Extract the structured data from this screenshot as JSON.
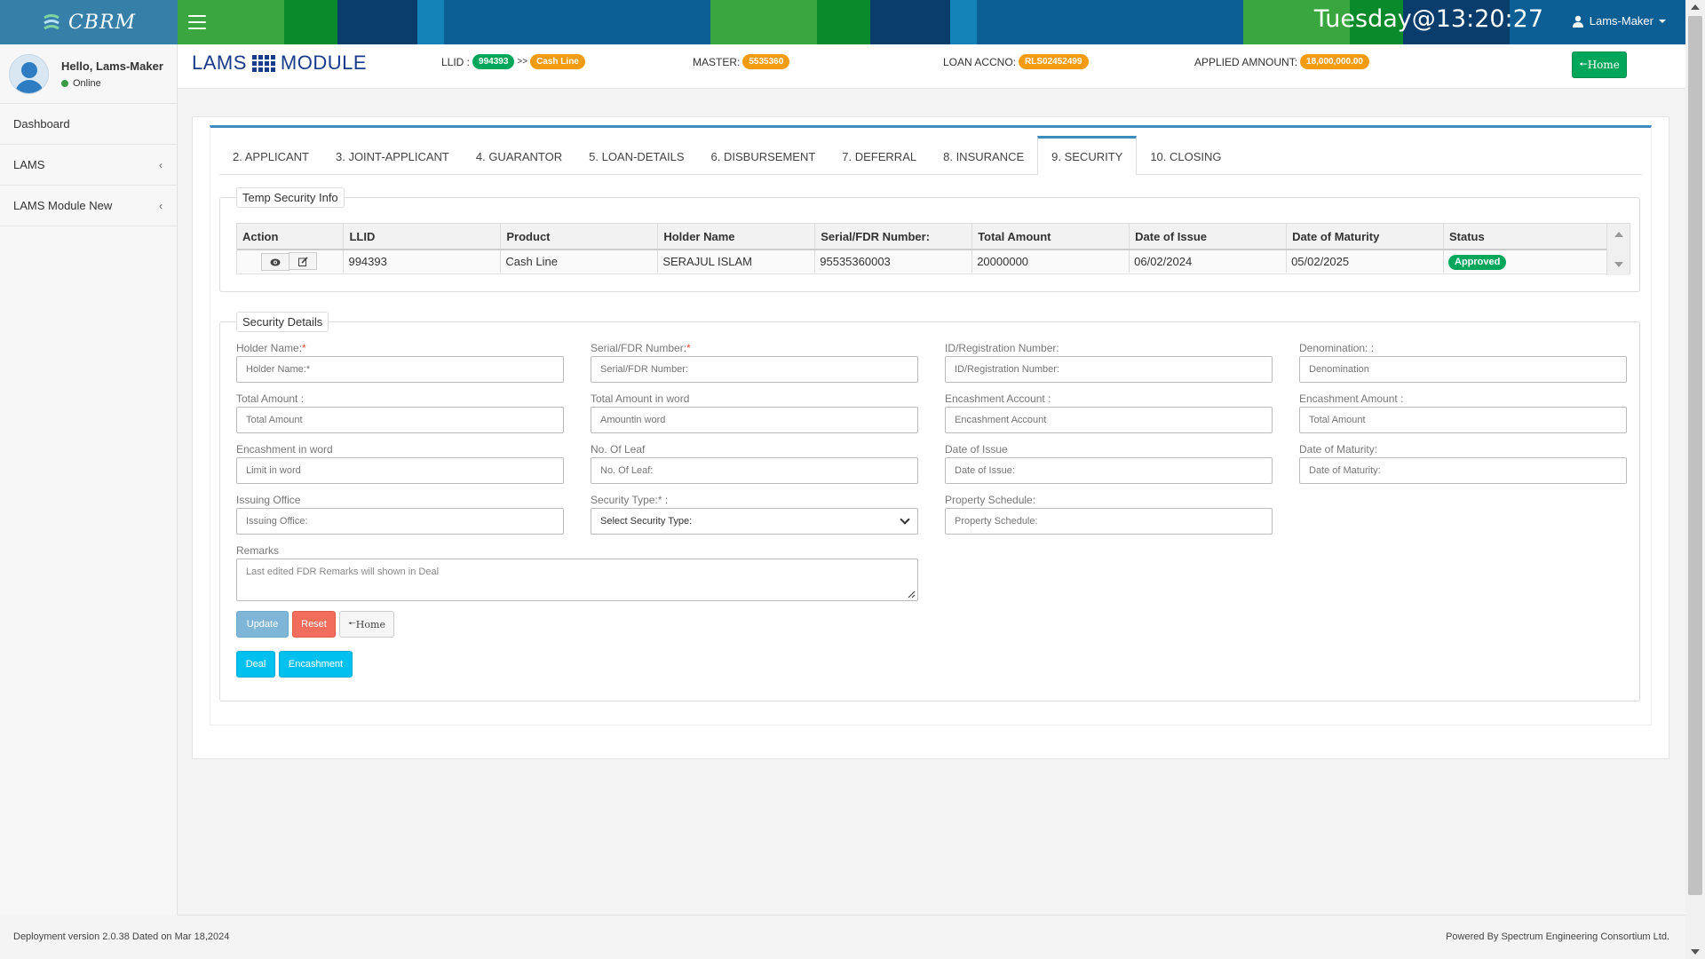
{
  "app": {
    "logo_text": "CBRM"
  },
  "header": {
    "clock": "Tuesday@13:20:27",
    "user_menu_label": "Lams-Maker"
  },
  "sidebar": {
    "greeting": "Hello, Lams-Maker",
    "status": "Online",
    "items": [
      {
        "label": "Dashboard"
      },
      {
        "label": "LAMS"
      },
      {
        "label": "LAMS Module New"
      }
    ]
  },
  "content_header": {
    "title_left": "LAMS",
    "title_right": "MODULE",
    "llid_label": "LLID :",
    "llid_value": "994393",
    "llid_sep": ">>",
    "product_value": "Cash Line",
    "master_label": "MASTER:",
    "master_value": "5535360",
    "loan_label": "LOAN ACCNO:",
    "loan_value": "RLS02452499",
    "applied_label": "APPLIED AMNOUNT:",
    "applied_value": "18,000,000.00",
    "home_label": "Home"
  },
  "tabs": [
    {
      "label": "2. APPLICANT"
    },
    {
      "label": "3. JOINT-APPLICANT"
    },
    {
      "label": "4. GUARANTOR"
    },
    {
      "label": "5. LOAN-DETAILS"
    },
    {
      "label": "6. DISBURSEMENT"
    },
    {
      "label": "7. DEFERRAL"
    },
    {
      "label": "8. INSURANCE"
    },
    {
      "label": "9. SECURITY",
      "active": true
    },
    {
      "label": "10. CLOSING"
    }
  ],
  "temp_security": {
    "legend": "Temp Security Info",
    "columns": [
      "Action",
      "LLID",
      "Product",
      "Holder Name",
      "Serial/FDR Number:",
      "Total Amount",
      "Date of Issue",
      "Date of Maturity",
      "Status"
    ],
    "rows": [
      {
        "llid": "994393",
        "product": "Cash Line",
        "holder": "SERAJUL ISLAM",
        "serial": "95535360003",
        "amount": "20000000",
        "issue": "06/02/2024",
        "maturity": "05/02/2025",
        "status": "Approved"
      }
    ]
  },
  "security_details": {
    "legend": "Security Details",
    "fields": {
      "holder_name": {
        "label": "Holder Name:",
        "required": "*",
        "placeholder": "Holder Name:*"
      },
      "serial_fdr": {
        "label": "Serial/FDR Number:",
        "required": "*",
        "placeholder": "Serial/FDR Number:"
      },
      "id_reg": {
        "label": "ID/Registration Number:",
        "placeholder": "ID/Registration Number:"
      },
      "denomination": {
        "label": "Denomination: :",
        "placeholder": "Denomination"
      },
      "total_amount": {
        "label": "Total Amount :",
        "placeholder": "Total Amount"
      },
      "total_amount_word": {
        "label": "Total Amount in word",
        "placeholder": "Amountin word"
      },
      "encash_account": {
        "label": "Encashment Account :",
        "placeholder": "Encashment Account"
      },
      "encash_amount": {
        "label": "Encashment Amount :",
        "placeholder": "Total Amount"
      },
      "encash_word": {
        "label": "Encashment in word",
        "placeholder": "Limit in word"
      },
      "no_of_leaf": {
        "label": "No. Of Leaf",
        "placeholder": "No. Of Leaf:"
      },
      "date_of_issue": {
        "label": "Date of Issue",
        "placeholder": "Date of Issue:"
      },
      "date_of_maturity": {
        "label": "Date of Maturity:",
        "placeholder": "Date of Maturity:"
      },
      "issuing_office": {
        "label": "Issuing Office",
        "placeholder": "Issuing Office:"
      },
      "security_type": {
        "label": "Security Type:* :",
        "selected": "Select Security Type:"
      },
      "property_schedule": {
        "label": "Property Schedule:",
        "placeholder": "Property Schedule:"
      },
      "remarks": {
        "label": "Remarks",
        "placeholder": "Last edited FDR Remarks will shown in Deal"
      }
    },
    "buttons": {
      "update": "Update",
      "reset": "Reset",
      "home": "Home",
      "deal": "Deal",
      "encashment": "Encashment"
    }
  },
  "footer": {
    "left": "Deployment version 2.0.38 Dated on Mar 18,2024",
    "right": "Powered By Spectrum Engineering Consortium Ltd."
  },
  "colors": {
    "brand_blue": "#3c8dbc",
    "success_green": "#00a65a",
    "warning_orange": "#f39c12",
    "danger_red": "#f26d5b",
    "info_cyan": "#00c0ef"
  }
}
